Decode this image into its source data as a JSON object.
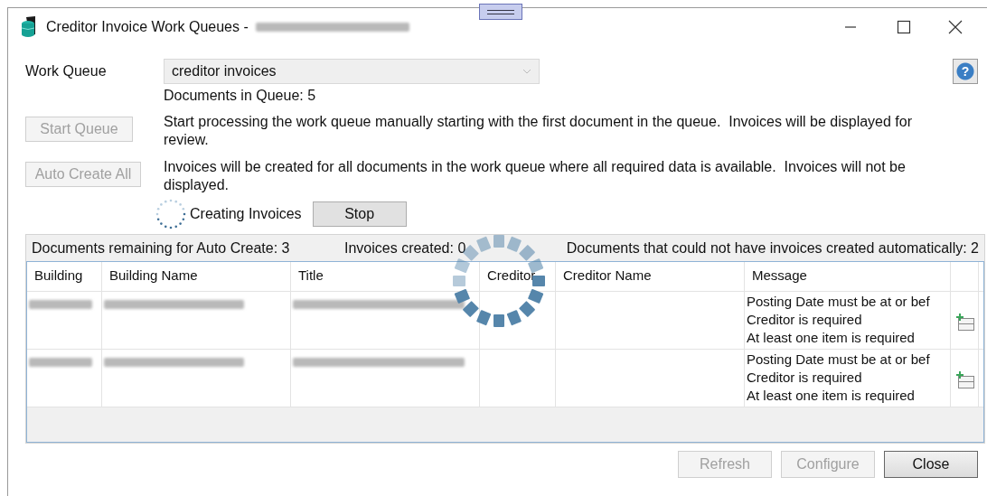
{
  "window": {
    "title": "Creditor Invoice Work Queues - ",
    "title_redacted": true
  },
  "work_queue": {
    "label": "Work Queue",
    "value": "creditor invoices",
    "help": "?"
  },
  "documents_in_queue": "Documents in Queue: 5",
  "actions": [
    {
      "label": "Start Queue",
      "disabled": true,
      "description": "Start processing the work queue manually starting with the first document in the queue.  Invoices will be displayed for review."
    },
    {
      "label": "Auto Create All",
      "disabled": true,
      "description": "Invoices will be created for all documents in the work queue where all required data is available.  Invoices will not be displayed."
    }
  ],
  "progress": {
    "busy": true,
    "label": "Creating Invoices",
    "stop": "Stop"
  },
  "summary": [
    "Documents remaining for Auto Create: 3",
    "Invoices created: 0",
    "Documents that could not have invoices created automatically: 2"
  ],
  "table": {
    "columns": [
      "Building",
      "Building Name",
      "Title",
      "Creditor",
      "Creditor Name",
      "Message"
    ],
    "rows": [
      {
        "cells": [
          {
            "kind": "redacted"
          },
          {
            "kind": "redacted"
          },
          {
            "kind": "redacted"
          },
          {
            "kind": "empty"
          },
          {
            "kind": "empty"
          },
          {
            "kind": "lines",
            "lines": [
              "Posting Date must be at or bef",
              "Creditor is required",
              "At least one item is required"
            ]
          },
          {
            "kind": "action"
          }
        ]
      },
      {
        "cells": [
          {
            "kind": "redacted"
          },
          {
            "kind": "redacted"
          },
          {
            "kind": "redacted"
          },
          {
            "kind": "empty"
          },
          {
            "kind": "empty"
          },
          {
            "kind": "lines",
            "lines": [
              "Posting Date must be at or bef",
              "Creditor is required",
              "At least one item is required"
            ]
          },
          {
            "kind": "action"
          }
        ]
      }
    ]
  },
  "buttons": [
    {
      "label": "Refresh",
      "disabled": true
    },
    {
      "label": "Configure",
      "disabled": true
    },
    {
      "label": "Close",
      "disabled": false
    }
  ]
}
